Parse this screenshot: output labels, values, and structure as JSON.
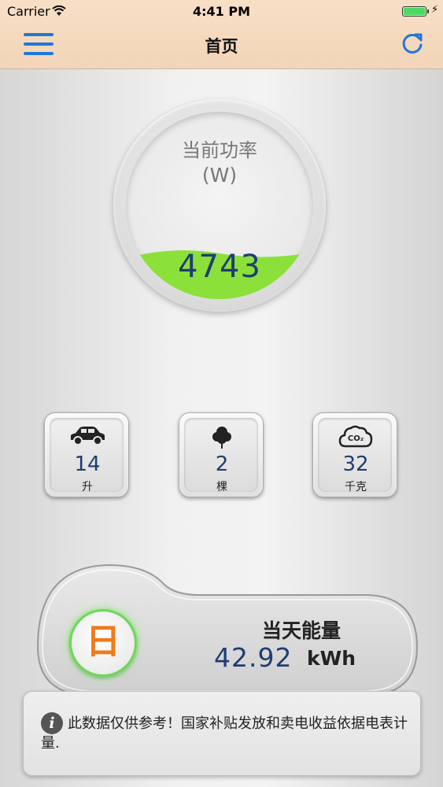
{
  "status_bar": {
    "carrier": "Carrier",
    "time": "4:41 PM",
    "battery_color": "#4cd964"
  },
  "nav": {
    "title": "首页",
    "menu_icon": "hamburger-menu-icon",
    "refresh_icon": "refresh-icon",
    "accent_color": "#1e78d8",
    "background_color": "#f5d9bd"
  },
  "gauge": {
    "label": "当前功率",
    "unit": "(W)",
    "value": "4743",
    "fill_color": "#8be03a"
  },
  "stats": [
    {
      "icon": "car-icon",
      "value": "14",
      "unit": "升"
    },
    {
      "icon": "tree-icon",
      "value": "2",
      "unit": "棵"
    },
    {
      "icon": "co2-cloud-icon",
      "value": "32",
      "unit": "千克"
    }
  ],
  "energy": {
    "period_button": "日",
    "title": "当天能量",
    "value": "42.92",
    "unit": "kWh"
  },
  "notice": {
    "icon": "info-icon",
    "text": "此数据仅供参考！国家补贴发放和卖电收益依据电表计量."
  }
}
